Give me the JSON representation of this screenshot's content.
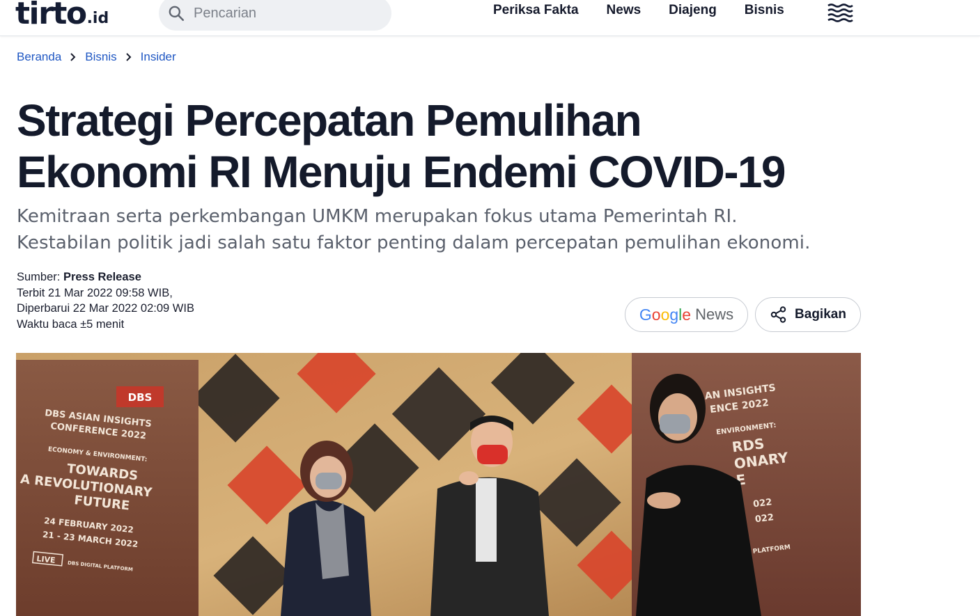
{
  "header": {
    "logo_main": "tirto",
    "logo_suffix": ".id",
    "search_placeholder": "Pencarian",
    "nav": [
      {
        "label": "Periksa Fakta"
      },
      {
        "label": "News"
      },
      {
        "label": "Diajeng"
      },
      {
        "label": "Bisnis"
      }
    ],
    "menu_icon": "waves-menu-icon"
  },
  "breadcrumb": [
    {
      "label": "Beranda"
    },
    {
      "label": "Bisnis"
    },
    {
      "label": "Insider"
    }
  ],
  "article": {
    "title_line1": "Strategi Percepatan Pemulihan",
    "title_line2": "Ekonomi RI Menuju Endemi COVID-19",
    "subtitle_line1": "Kemitraan serta perkembangan UMKM merupakan fokus utama Pemerintah RI.",
    "subtitle_line2": "Kestabilan politik jadi salah satu faktor penting dalam percepatan pemulihan ekonomi.",
    "source_label": "Sumber:",
    "source_value": "Press Release",
    "published": "Terbit 21 Mar 2022 09:58 WIB,",
    "updated": "Diperbarui 22 Mar 2022 02:09 WIB",
    "read_time": "Waktu baca ±5 menit"
  },
  "actions": {
    "google_news_brand": [
      "G",
      "o",
      "o",
      "g",
      "l",
      "e"
    ],
    "google_news_label": "News",
    "share_label": "Bagikan"
  },
  "hero": {
    "banner_left": {
      "brand": "DBS",
      "line1": "DBS ASIAN INSIGHTS",
      "line2": "CONFERENCE 2022",
      "line3": "ECONOMY & ENVIRONMENT:",
      "line4": "TOWARDS",
      "line5": "A REVOLUTIONARY",
      "line6": "FUTURE",
      "date1": "24 FEBRUARY 2022",
      "date2": "21 - 23 MARCH 2022",
      "live": "LIVE",
      "platform": "DBS DIGITAL PLATFORM"
    },
    "banner_right": {
      "line1": "AN INSIGHTS",
      "line2": "ENCE 2022",
      "line3": "ENVIRONMENT:",
      "line4": "RDS",
      "line5": "ONARY",
      "line6": "E",
      "date1": "022",
      "date2": "022",
      "platform": "TAL PLATFORM"
    }
  },
  "colors": {
    "brand_navy": "#141c33",
    "link_blue": "#1f57c3",
    "google_blue": "#4285F4",
    "google_red": "#EA4335",
    "google_yellow": "#FBBC05",
    "google_green": "#34A853"
  }
}
